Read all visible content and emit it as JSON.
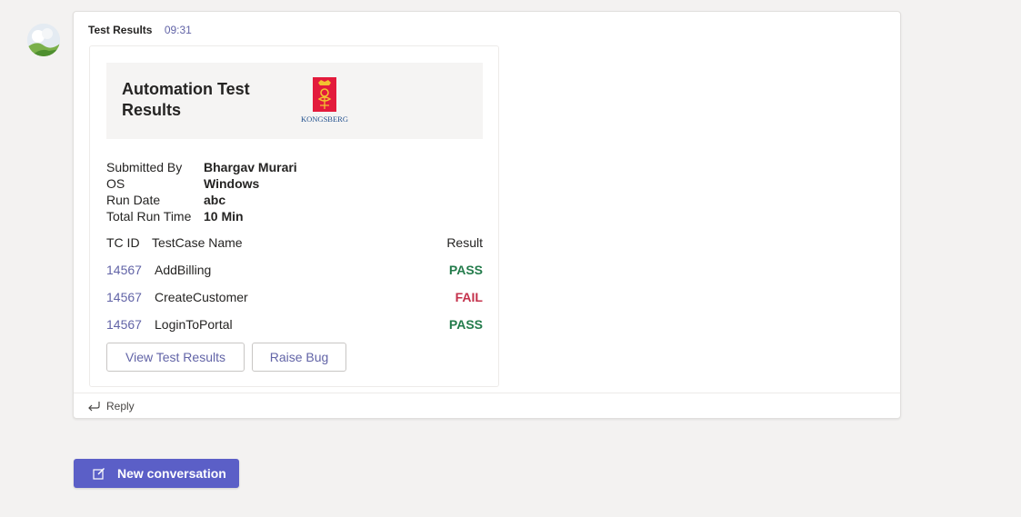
{
  "message": {
    "sender": "Test Results",
    "time": "09:31",
    "reply_label": "Reply"
  },
  "card": {
    "title": "Automation Test Results",
    "logo_text": "KONGSBERG",
    "facts": [
      {
        "key": "Submitted By",
        "value": "Bhargav Murari"
      },
      {
        "key": "OS",
        "value": "Windows"
      },
      {
        "key": "Run Date",
        "value": "abc"
      },
      {
        "key": "Total Run Time",
        "value": "10 Min"
      }
    ],
    "columns": {
      "id": "TC ID",
      "name": "TestCase Name",
      "result": "Result"
    },
    "rows": [
      {
        "id": "14567",
        "name": "AddBilling",
        "result": "PASS"
      },
      {
        "id": "14567",
        "name": "CreateCustomer",
        "result": "FAIL"
      },
      {
        "id": "14567",
        "name": "LoginToPortal",
        "result": "PASS"
      }
    ],
    "actions": {
      "view": "View Test Results",
      "bug": "Raise Bug"
    }
  },
  "compose": {
    "new_conversation": "New conversation"
  },
  "colors": {
    "accent": "#6264a7",
    "pass": "#237b4b",
    "fail": "#c4314b",
    "button": "#5b5fc7"
  }
}
